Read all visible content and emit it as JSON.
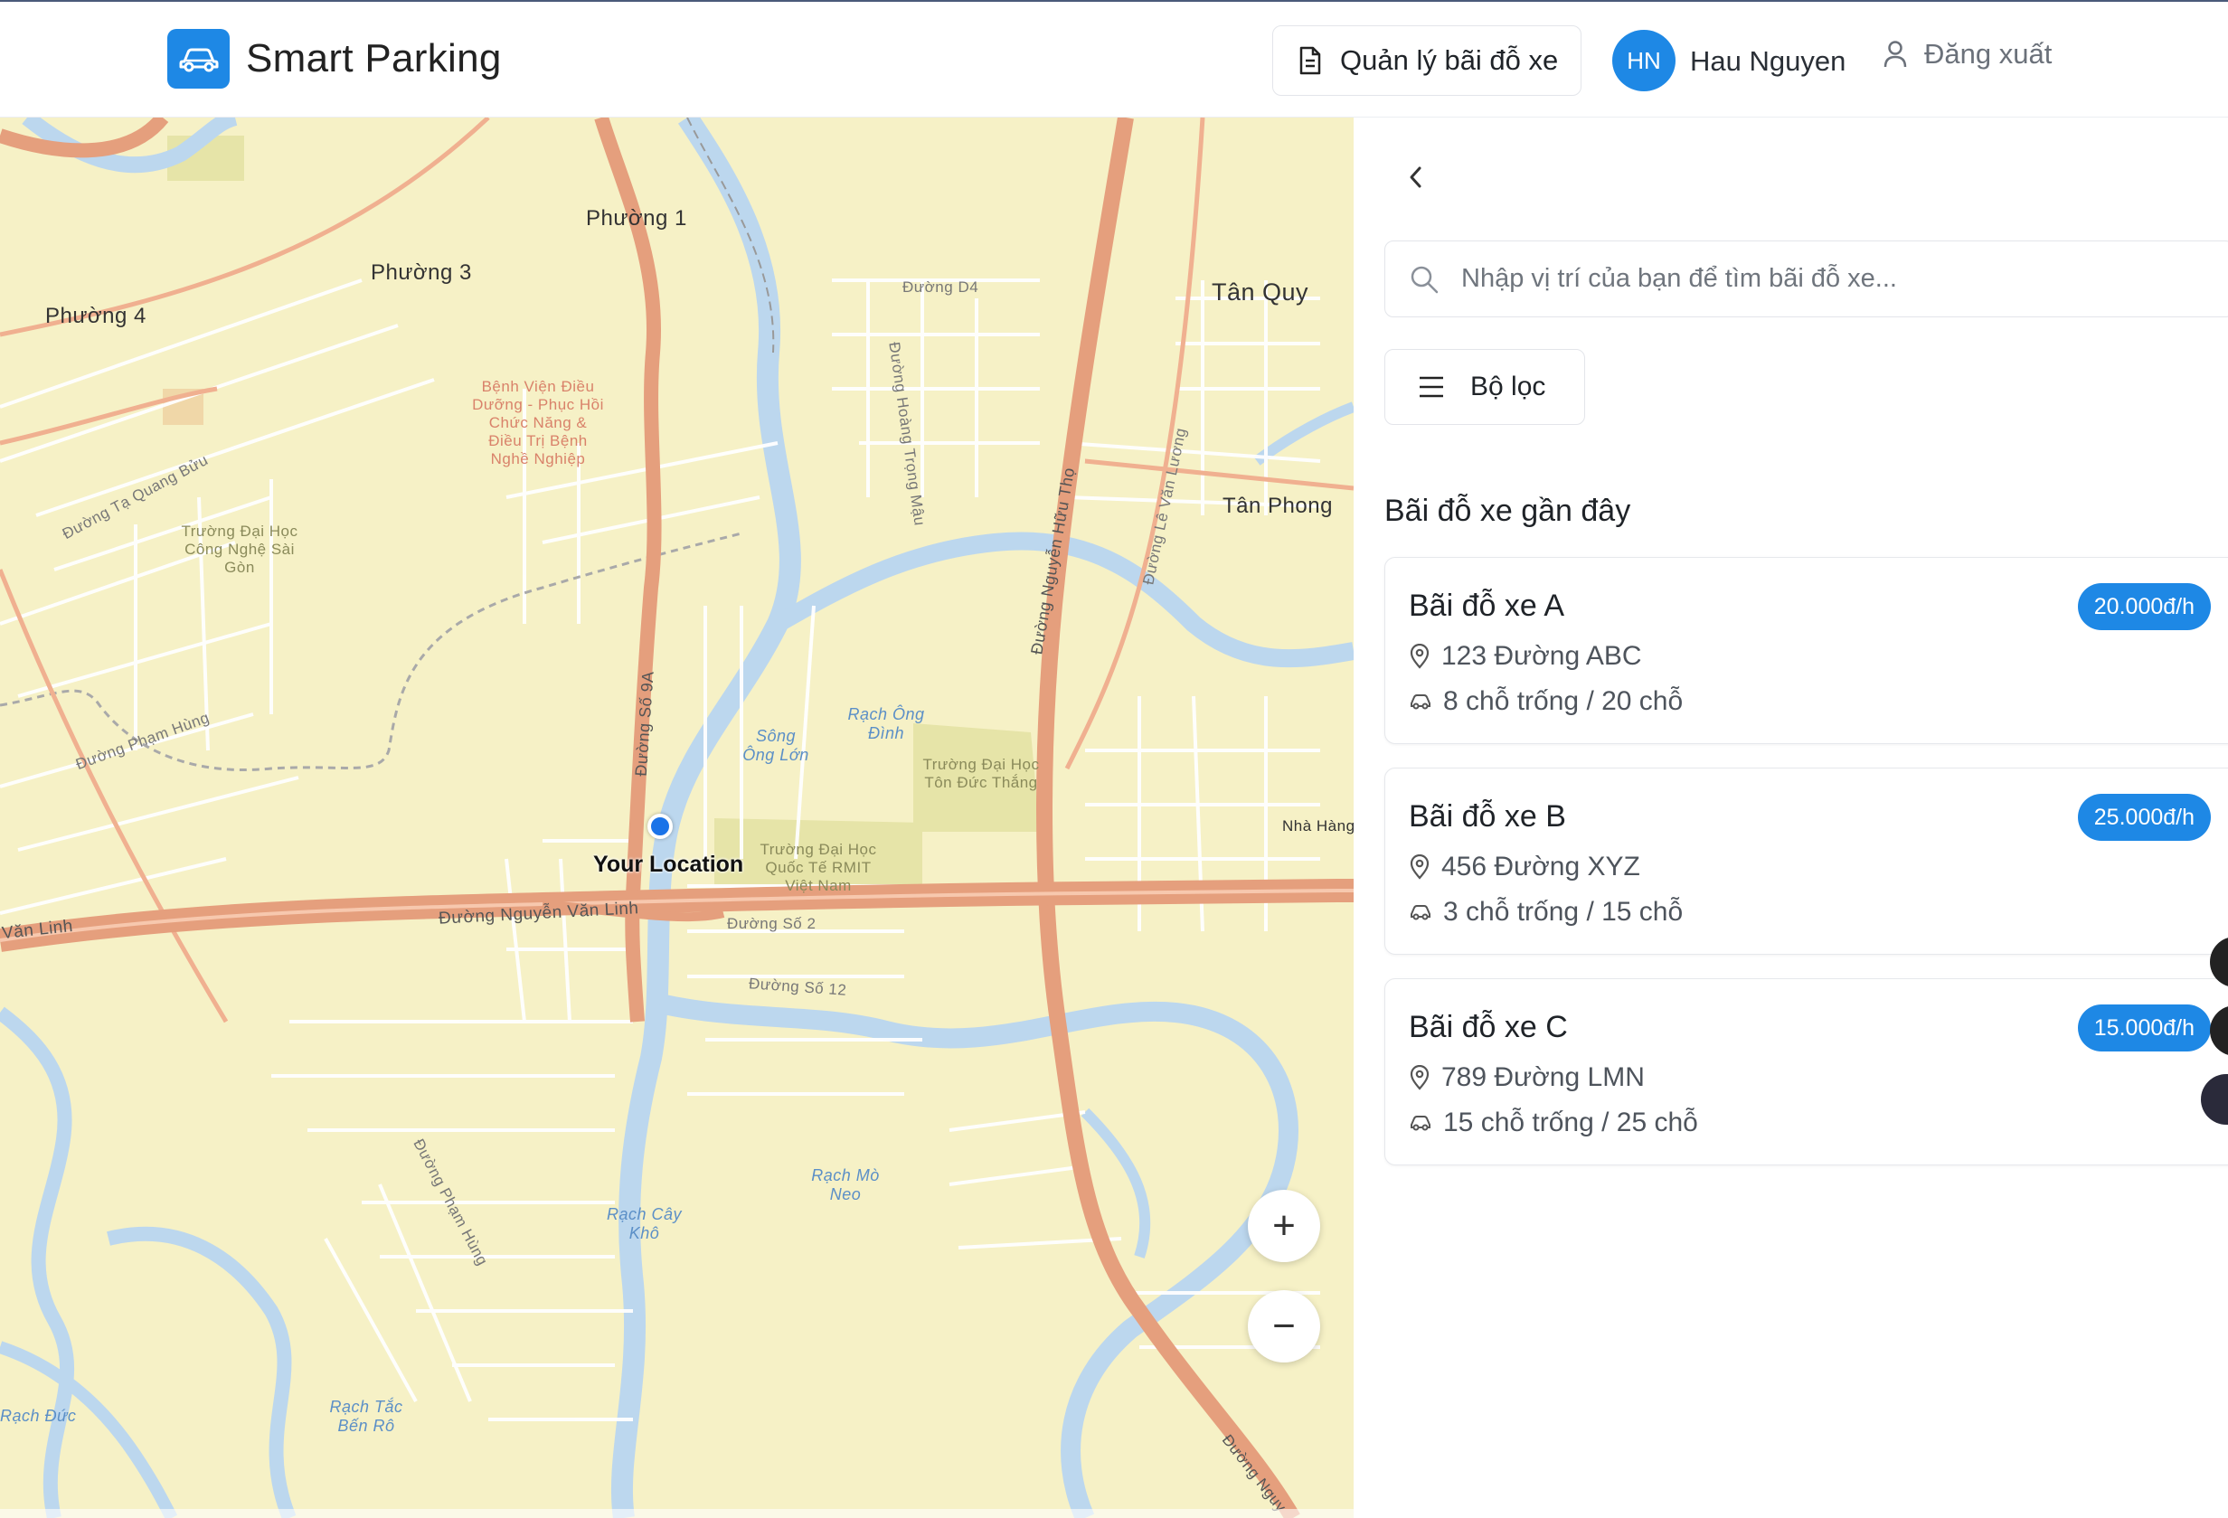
{
  "header": {
    "app_title": "Smart Parking",
    "logo_icon": "car-icon",
    "manage_label": "Quản lý bãi đỗ xe",
    "avatar_initials": "HN",
    "user_name": "Hau Nguyen",
    "logout_label": "Đăng xuất"
  },
  "map": {
    "your_location": "Your Location",
    "zoom_in": "+",
    "zoom_out": "−",
    "labels": {
      "p1": "Phường 1",
      "p3": "Phường 3",
      "p4": "Phường 4",
      "tanquy": "Tân Quy",
      "tanphong": "Tân Phong",
      "nvl": "Đường Nguyễn Văn Linh",
      "vanlinh": "Văn Linh",
      "so9a": "Đường Số 9A",
      "nht": "Đường Nguyễn Hữu Thọ",
      "lvl": "Đường Lê Văn Lương",
      "hoangtrongmau": "Đường Hoàng Trọng Mậu",
      "tqb": "Đường Tạ Quang Bửu",
      "phamhung": "Đường Phạm Hùng",
      "phamhung2": "Đường Phạm Hùng",
      "d4": "Đường D4",
      "so2": "Đường Số 2",
      "so12": "Đường Số 12",
      "hospital": "Bệnh Viện Điều Dưỡng - Phục Hồi Chức Năng & Điều Trị Bệnh Nghề Nghiệp",
      "cnsg": "Trường Đại Học Công Nghệ Sài Gòn",
      "tdt": "Trường Đại Học Tôn Đức Thắng",
      "rmit": "Trường Đại Học Quốc Tế RMIT Việt Nam",
      "songonglon": "Sông Ông Lớn",
      "rachongdinh": "Rạch Ông Đình",
      "rachmoneo": "Rạch Mò Neo",
      "rachcaykho": "Rạch Cây Khô",
      "rachtacbenro": "Rạch Tắc Bến Rô",
      "rachduc": "Rạch Đức",
      "nhahang": "Nhà Hàng",
      "nguyen": "Đường Nguy"
    }
  },
  "panel": {
    "search_placeholder": "Nhập vị trí của bạn để tìm bãi đỗ xe...",
    "filter_label": "Bộ lọc",
    "section_title": "Bãi đỗ xe gần đây",
    "lots": [
      {
        "name": "Bãi đỗ xe A",
        "price": "20.000đ/h",
        "address": "123 Đường ABC",
        "availability": "8 chỗ trống / 20 chỗ"
      },
      {
        "name": "Bãi đỗ xe B",
        "price": "25.000đ/h",
        "address": "456 Đường XYZ",
        "availability": "3 chỗ trống / 15 chỗ"
      },
      {
        "name": "Bãi đỗ xe C",
        "price": "15.000đ/h",
        "address": "789 Đường LMN",
        "availability": "15 chỗ trống / 25 chỗ"
      }
    ]
  },
  "colors": {
    "primary": "#1e88e5",
    "map_land": "#f6f1c6",
    "map_water": "#bcd7ee",
    "map_highway": "#e8a07e"
  }
}
